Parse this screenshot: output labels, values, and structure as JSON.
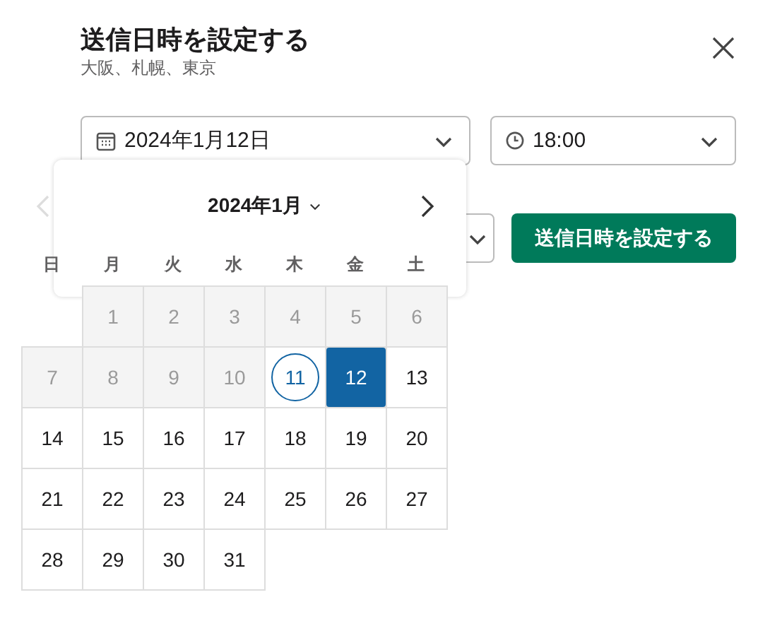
{
  "dialog": {
    "title": "送信日時を設定する",
    "subtitle": "大阪、札幌、東京"
  },
  "date_field": {
    "value": "2024年1月12日"
  },
  "time_field": {
    "value": "18:00"
  },
  "submit_button": "送信日時を設定する",
  "calendar": {
    "month_label": "2024年1月",
    "prev_disabled": true,
    "weekdays": [
      "日",
      "月",
      "火",
      "水",
      "木",
      "金",
      "土"
    ],
    "weeks": [
      [
        {
          "label": "1",
          "kind": "past",
          "selected": false
        },
        {
          "label": "2",
          "kind": "past",
          "selected": false
        },
        {
          "label": "3",
          "kind": "past",
          "selected": false
        },
        {
          "label": "4",
          "kind": "past",
          "selected": false
        },
        {
          "label": "5",
          "kind": "past",
          "selected": false
        },
        {
          "label": "6",
          "kind": "past",
          "selected": false
        }
      ],
      [
        {
          "label": "7",
          "kind": "past",
          "selected": false
        },
        {
          "label": "8",
          "kind": "past",
          "selected": false
        },
        {
          "label": "9",
          "kind": "past",
          "selected": false
        },
        {
          "label": "10",
          "kind": "past",
          "selected": false
        },
        {
          "label": "11",
          "kind": "today",
          "selected": false
        },
        {
          "label": "12",
          "kind": "normal",
          "selected": true
        },
        {
          "label": "13",
          "kind": "normal",
          "selected": false
        }
      ],
      [
        {
          "label": "14",
          "kind": "normal",
          "selected": false
        },
        {
          "label": "15",
          "kind": "normal",
          "selected": false
        },
        {
          "label": "16",
          "kind": "normal",
          "selected": false
        },
        {
          "label": "17",
          "kind": "normal",
          "selected": false
        },
        {
          "label": "18",
          "kind": "normal",
          "selected": false
        },
        {
          "label": "19",
          "kind": "normal",
          "selected": false
        },
        {
          "label": "20",
          "kind": "normal",
          "selected": false
        }
      ],
      [
        {
          "label": "21",
          "kind": "normal",
          "selected": false
        },
        {
          "label": "22",
          "kind": "normal",
          "selected": false
        },
        {
          "label": "23",
          "kind": "normal",
          "selected": false
        },
        {
          "label": "24",
          "kind": "normal",
          "selected": false
        },
        {
          "label": "25",
          "kind": "normal",
          "selected": false
        },
        {
          "label": "26",
          "kind": "normal",
          "selected": false
        },
        {
          "label": "27",
          "kind": "normal",
          "selected": false
        }
      ],
      [
        {
          "label": "28",
          "kind": "normal",
          "selected": false
        },
        {
          "label": "29",
          "kind": "normal",
          "selected": false
        },
        {
          "label": "30",
          "kind": "normal",
          "selected": false
        },
        {
          "label": "31",
          "kind": "normal",
          "selected": false
        }
      ]
    ]
  }
}
